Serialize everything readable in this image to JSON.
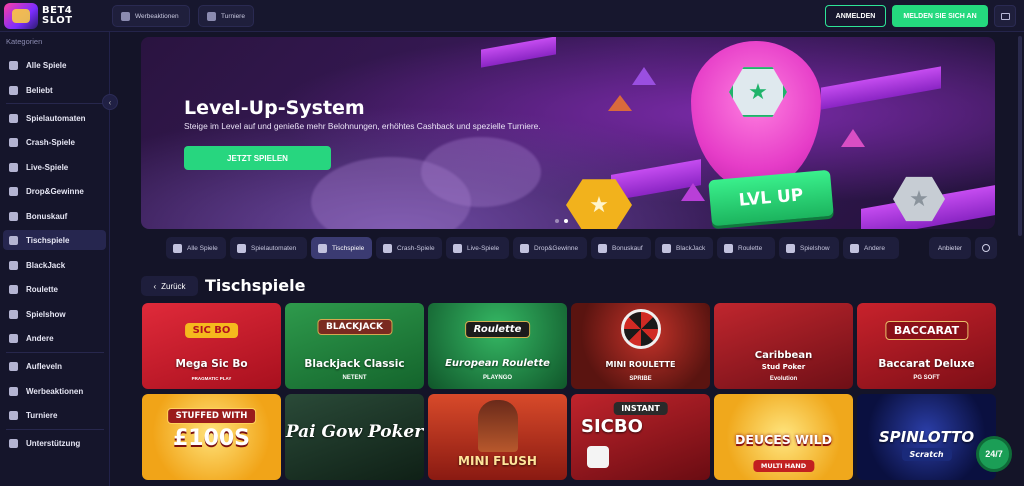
{
  "header": {
    "logo_text": "BET4 SLOT",
    "nav": [
      {
        "label": "Werbeaktionen",
        "icon": "megaphone-icon"
      },
      {
        "label": "Turniere",
        "icon": "trophy-icon"
      }
    ],
    "login_label": "ANMELDEN",
    "register_label": "MELDEN SIE SICH AN",
    "settings_icon": "settings-icon"
  },
  "sidebar": {
    "category_title": "Kategorien",
    "items": [
      {
        "label": "Alle Spiele",
        "icon": "grid-icon"
      },
      {
        "label": "Beliebt",
        "icon": "star-icon"
      },
      {
        "label": "Spielautomaten",
        "icon": "slot-icon"
      },
      {
        "label": "Crash-Spiele",
        "icon": "plane-icon"
      },
      {
        "label": "Live-Spiele",
        "icon": "live-icon"
      },
      {
        "label": "Drop&Gewinne",
        "icon": "drop-icon"
      },
      {
        "label": "Bonuskauf",
        "icon": "gift-icon"
      },
      {
        "label": "Tischspiele",
        "icon": "cards-icon"
      },
      {
        "label": "BlackJack",
        "icon": "chip-icon"
      },
      {
        "label": "Roulette",
        "icon": "roulette-icon"
      },
      {
        "label": "Spielshow",
        "icon": "show-icon"
      },
      {
        "label": "Andere",
        "icon": "more-icon"
      },
      {
        "label": "Aufleveln",
        "icon": "level-icon"
      },
      {
        "label": "Werbeaktionen",
        "icon": "megaphone-icon"
      },
      {
        "label": "Turniere",
        "icon": "trophy-icon"
      },
      {
        "label": "Unterstützung",
        "icon": "support-icon"
      }
    ],
    "active_item": "Tischspiele"
  },
  "banner": {
    "title": "Level-Up-System",
    "subtitle": "Steige im Level auf und genieße mehr Belohnungen, erhöhtes Cashback und spezielle Turniere.",
    "cta_label": "JETZT SPIELEN",
    "art_label": "LVL UP",
    "slide_index": 1,
    "slide_count": 2
  },
  "filters": {
    "chips": [
      {
        "label": "Alle Spiele",
        "icon": "grid-icon"
      },
      {
        "label": "Spielautomaten",
        "icon": "slot-icon"
      },
      {
        "label": "Tischspiele",
        "icon": "cards-icon"
      },
      {
        "label": "Crash-Spiele",
        "icon": "plane-icon"
      },
      {
        "label": "Live-Spiele",
        "icon": "live-icon"
      },
      {
        "label": "Drop&Gewinne",
        "icon": "drop-icon"
      },
      {
        "label": "Bonuskauf",
        "icon": "gift-icon"
      },
      {
        "label": "BlackJack",
        "icon": "chip-icon"
      },
      {
        "label": "Roulette",
        "icon": "roulette-icon"
      },
      {
        "label": "Spielshow",
        "icon": "show-icon"
      },
      {
        "label": "Andere",
        "icon": "more-icon"
      }
    ],
    "active_chip": "Tischspiele",
    "provider_label": "Anbieter",
    "search_icon": "search-icon"
  },
  "section": {
    "back_label": "Zurück",
    "title": "Tischspiele"
  },
  "games": [
    {
      "name": "Mega Sic Bo",
      "badge": "SIC BO",
      "provider": "PRAGMATIC PLAY"
    },
    {
      "name": "Blackjack Classic",
      "badge": "BLACKJACK",
      "provider": "NETENT"
    },
    {
      "name": "European Roulette",
      "badge": "Roulette",
      "provider": "PLAYNGO"
    },
    {
      "name": "MINI ROULETTE",
      "badge": "",
      "provider": "SPRIBE"
    },
    {
      "name": "Caribbean",
      "badge": "Stud Poker",
      "provider": "Evolution"
    },
    {
      "name": "Baccarat Deluxe",
      "badge": "BACCARAT",
      "provider": "PG SOFT"
    },
    {
      "name": "£100S",
      "badge": "STUFFED WITH",
      "provider": ""
    },
    {
      "name": "Pai Gow Poker",
      "badge": "",
      "provider": ""
    },
    {
      "name": "MINI FLUSH",
      "badge": "",
      "provider": ""
    },
    {
      "name": "SICBO",
      "badge": "INSTANT",
      "provider": ""
    },
    {
      "name": "DEUCES WILD",
      "badge": "MULTI HAND",
      "provider": ""
    },
    {
      "name": "SPINLOTTO",
      "badge": "Scratch",
      "provider": ""
    }
  ],
  "chat": {
    "label": "24/7"
  },
  "colors": {
    "accent_green": "#24d97e",
    "background": "#141428",
    "sidebar_active": "#26264f"
  }
}
